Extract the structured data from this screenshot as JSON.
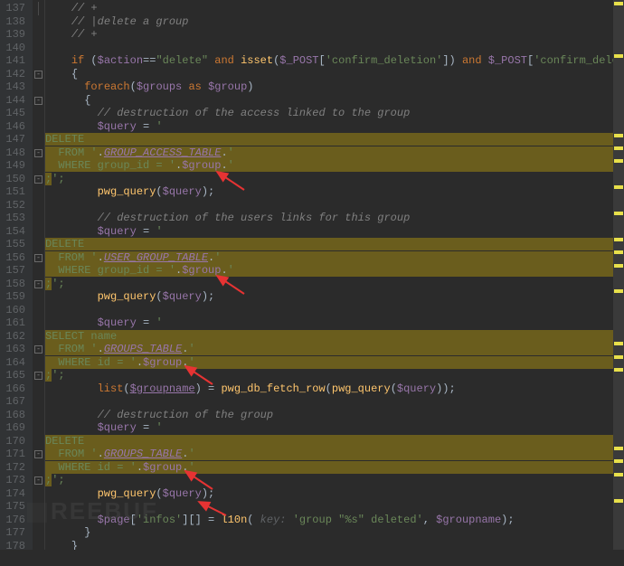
{
  "lines": {
    "start": 137,
    "end": 178
  },
  "code": {
    "l137": "// +",
    "l138": "// |delete a group",
    "l139": "// +",
    "l140": "",
    "l141_if": "if",
    "l141_a": " (",
    "l141_var1": "$action",
    "l141_eq": "==",
    "l141_s1": "\"delete\"",
    "l141_and1": " and ",
    "l141_isset": "isset",
    "l141_b": "(",
    "l141_post1": "$_POST",
    "l141_c": "[",
    "l141_s2": "'confirm_deletion'",
    "l141_d": "]) ",
    "l141_and2": "and ",
    "l141_post2": "$_POST",
    "l141_e": "[",
    "l141_s3": "'confirm_deletion'",
    "l141_f": "])",
    "l142o": "{",
    "l143_fe": "foreach",
    "l143_a": "(",
    "l143_groups": "$groups",
    "l143_as": " as ",
    "l143_group": "$group",
    "l143_b": ")",
    "l144o": "{",
    "l145": "// destruction of the access linked to the group",
    "l146_q": "$query",
    "l146_eq": " = ",
    "l146_s": "'",
    "l147": "DELETE",
    "l148a": "  FROM ",
    "l148b": ".",
    "l148c": "GROUP_ACCESS_TABLE",
    "l148d": ".",
    "l149a": "  WHERE group_id = ",
    "l149b": ".",
    "l149c": "$group",
    "l149d": ".",
    "l150a": ";",
    "l150b": "';",
    "l151_fn": "pwg_query",
    "l151_a": "(",
    "l151_q": "$query",
    "l151_b": ");",
    "l152": "",
    "l153": "// destruction of the users links for this group",
    "l154_s": "'",
    "l155": "DELETE",
    "l156a": "  FROM ",
    "l156c": "USER_GROUP_TABLE",
    "l157a": "  WHERE group_id = ",
    "l162": "SELECT name",
    "l163a": "  FROM ",
    "l163c": "GROUPS_TABLE",
    "l164a": "  WHERE id = ",
    "l166_list": "list",
    "l166_a": "(",
    "l166_gn": "$groupname",
    "l166_b": ") = ",
    "l166_fn": "pwg_db_fetch_row",
    "l166_c": "(",
    "l166_pwg": "pwg_query",
    "l166_d": "(",
    "l166_q": "$query",
    "l166_e": "));",
    "l168": "// destruction of the group",
    "l176_page": "$page",
    "l176_a": "[",
    "l176_s1": "'infos'",
    "l176_b": "][] = ",
    "l176_l10n": "l10n",
    "l176_c": "(",
    "l176_hint": " key: ",
    "l176_s2": "'group \"%s\" deleted'",
    "l176_d": ", ",
    "l176_gn": "$groupname",
    "l176_e": ");",
    "l177c": "}",
    "l178c": "}"
  },
  "fold_boxes": [
    "-",
    "-",
    "-",
    "-",
    "-",
    "-",
    "-",
    "-",
    "-",
    "-"
  ],
  "watermark": "REEBUF"
}
